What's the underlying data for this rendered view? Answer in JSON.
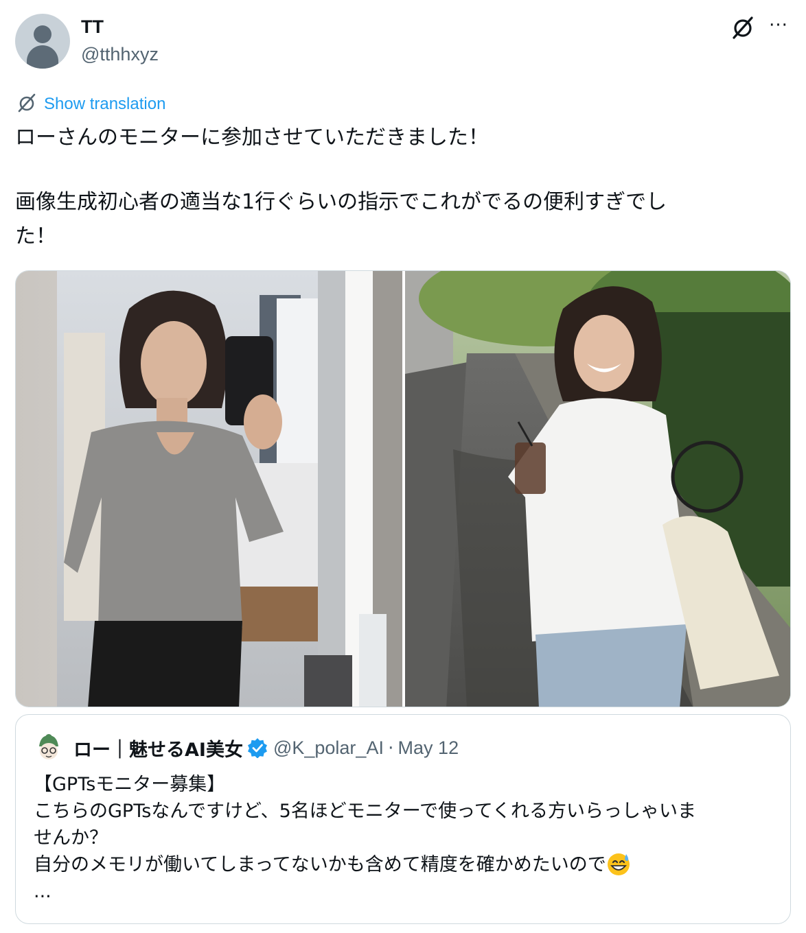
{
  "author": {
    "display_name": "TT",
    "handle": "@tthhxyz"
  },
  "header_icons": [
    "grok-icon",
    "more-icon"
  ],
  "more_label": "···",
  "translation_link": "Show translation",
  "tweet_lines": [
    "ローさんのモニターに参加させていただきました！",
    "画像生成初心者の適当な1行ぐらいの指示でこれがでるの便利すぎでし",
    "た！"
  ],
  "media": [
    {
      "icon": "photo-mirror-selfie-icon"
    },
    {
      "icon": "photo-street-smile-icon"
    }
  ],
  "quoted_tweet": {
    "display_name": "ロー｜魅せるAI美女",
    "verified": true,
    "handle": "@K_polar_AI",
    "separator": "·",
    "date": "May 12",
    "lines": [
      "【GPTsモニター募集】",
      "こちらのGPTsなんですけど、5名ほどモニターで使ってくれる方いらっしゃいま",
      "せんか？",
      "自分のメモリが働いてしまってないかも含めて精度を確かめたいので",
      "..."
    ],
    "emoji": "grinning-face-with-sweat-icon"
  },
  "colors": {
    "text": "#0f1419",
    "secondary": "#536471",
    "link": "#1d9bf0",
    "border": "#cfd9de",
    "verified": "#1d9bf0"
  }
}
